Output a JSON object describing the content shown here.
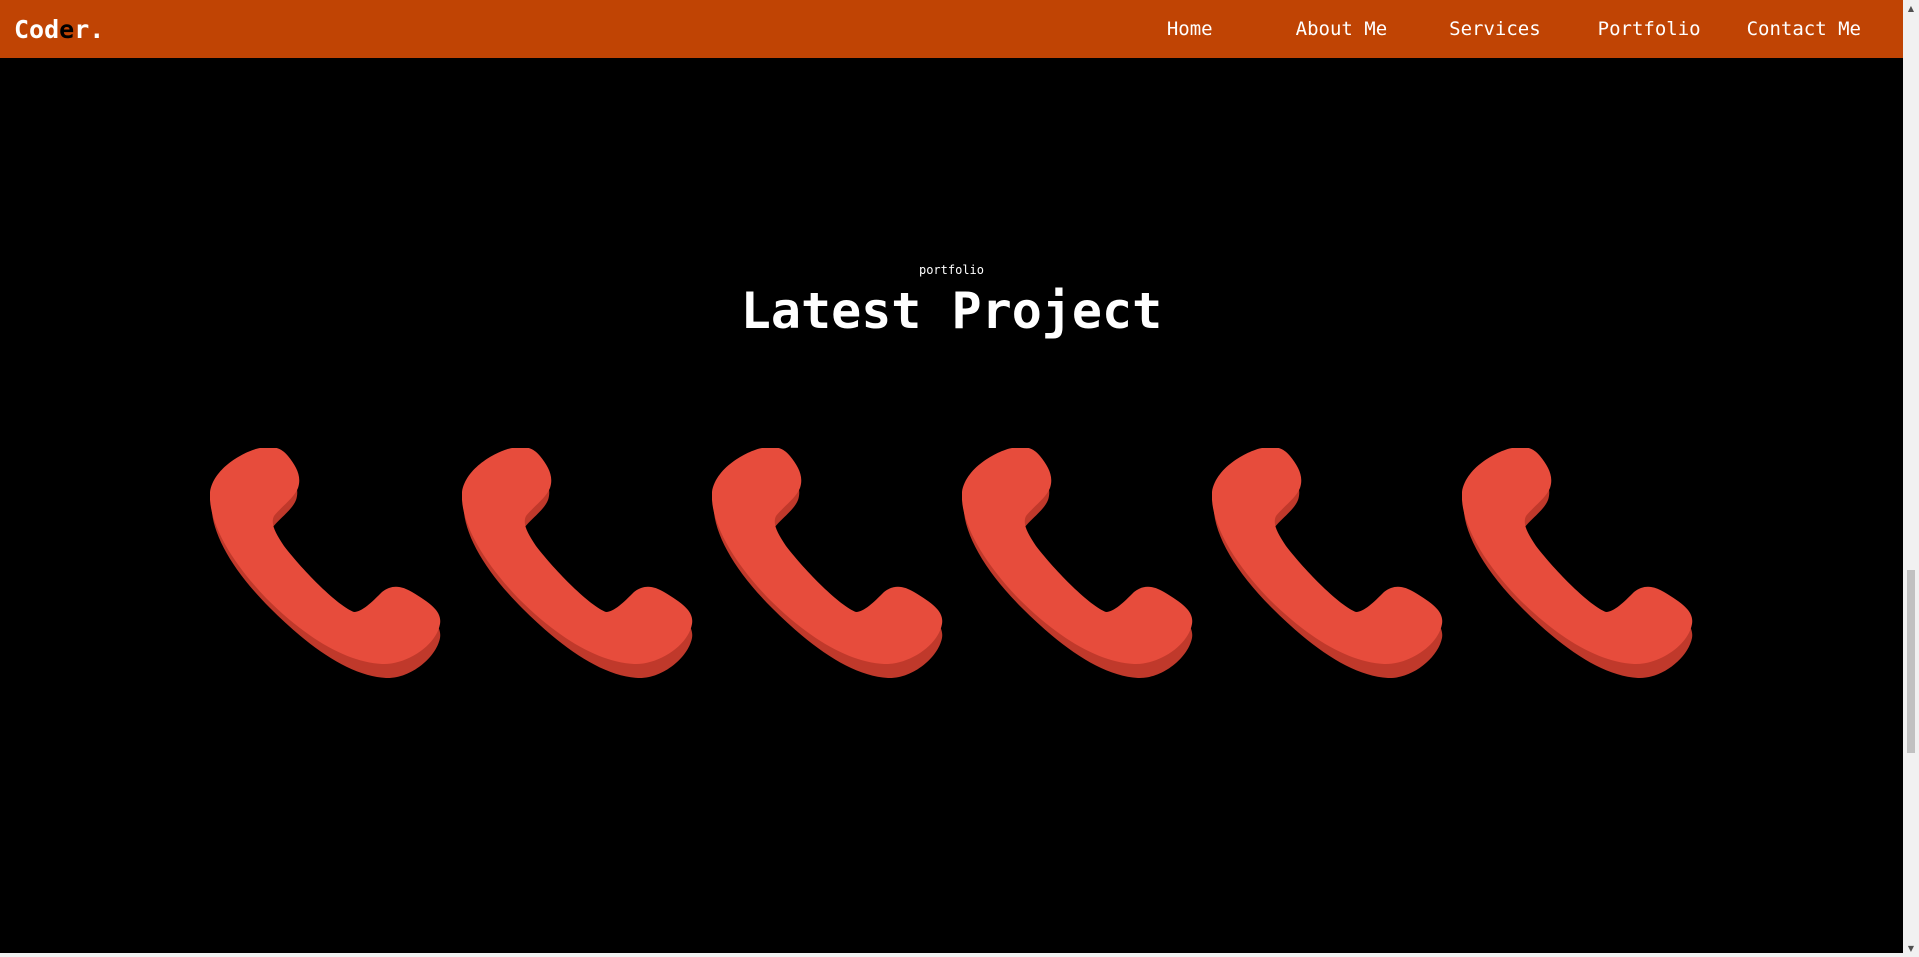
{
  "navbar": {
    "logo": {
      "part1": "Cod",
      "part2": "e",
      "part3": "r."
    },
    "links": [
      {
        "label": "Home"
      },
      {
        "label": "About Me"
      },
      {
        "label": "Services"
      },
      {
        "label": "Portfolio"
      },
      {
        "label": "Contact Me"
      }
    ]
  },
  "portfolio": {
    "subheading": "portfolio",
    "heading": "Latest Project",
    "projects": [
      {
        "icon": "phone-icon"
      },
      {
        "icon": "phone-icon"
      },
      {
        "icon": "phone-icon"
      },
      {
        "icon": "phone-icon"
      },
      {
        "icon": "phone-icon"
      },
      {
        "icon": "phone-icon"
      }
    ]
  },
  "colors": {
    "navbar_bg": "#c04404",
    "page_bg": "#000000",
    "text": "#ffffff",
    "icon_main": "#e74c3c",
    "icon_shadow": "#c0392b"
  }
}
